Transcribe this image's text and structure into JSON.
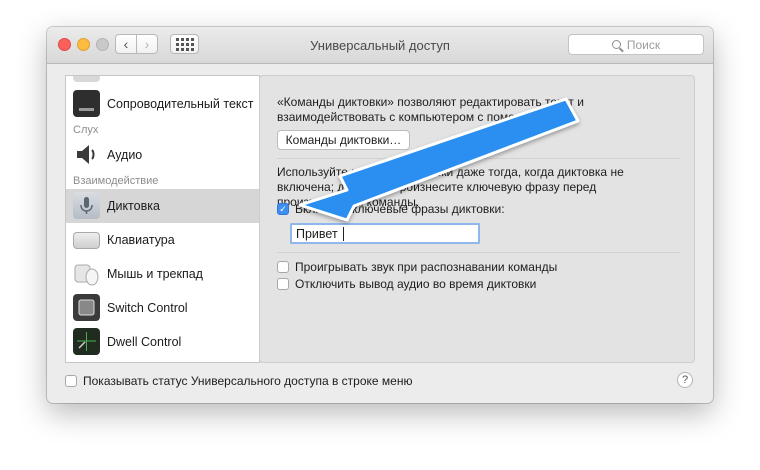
{
  "window": {
    "title": "Универсальный доступ"
  },
  "search": {
    "placeholder": "Поиск"
  },
  "sidebar": {
    "items": [
      {
        "label": "Сопроводительный текст",
        "icon": "captions-icon"
      },
      {
        "label": "Аудио",
        "icon": "speaker-icon"
      },
      {
        "label": "Диктовка",
        "icon": "microphone-icon",
        "selected": true
      },
      {
        "label": "Клавиатура",
        "icon": "keyboard-icon"
      },
      {
        "label": "Мышь и трекпад",
        "icon": "mouse-trackpad-icon"
      },
      {
        "label": "Switch Control",
        "icon": "switch-control-icon"
      },
      {
        "label": "Dwell Control",
        "icon": "dwell-control-icon"
      }
    ],
    "sections": {
      "hearing": "Слух",
      "interaction": "Взаимодействие"
    }
  },
  "panel": {
    "description": "«Команды диктовки» позволяют редактировать текст и взаимодействовать с компьютером с помощью речи.",
    "commands_button": "Команды диктовки…",
    "keyphrase_description": "Используйте команды диктовки даже тогда, когда диктовка не включена; для этого произнесите ключевую фразу перед произнесением команды.",
    "enable_keyphrase": {
      "label": "Включить ключевые фразы диктовки:",
      "checked": true
    },
    "keyphrase_value": "Привет",
    "play_sound": {
      "label": "Проигрывать звук при распознавании команды",
      "checked": false
    },
    "mute_audio": {
      "label": "Отключить вывод аудио во время диктовки",
      "checked": false
    }
  },
  "footer": {
    "show_status": {
      "label": "Показывать статус Универсального доступа в строке меню",
      "checked": false
    },
    "help": "?"
  },
  "annotation": {
    "color": "#2b8ff0",
    "icon": "pointer-arrow"
  }
}
